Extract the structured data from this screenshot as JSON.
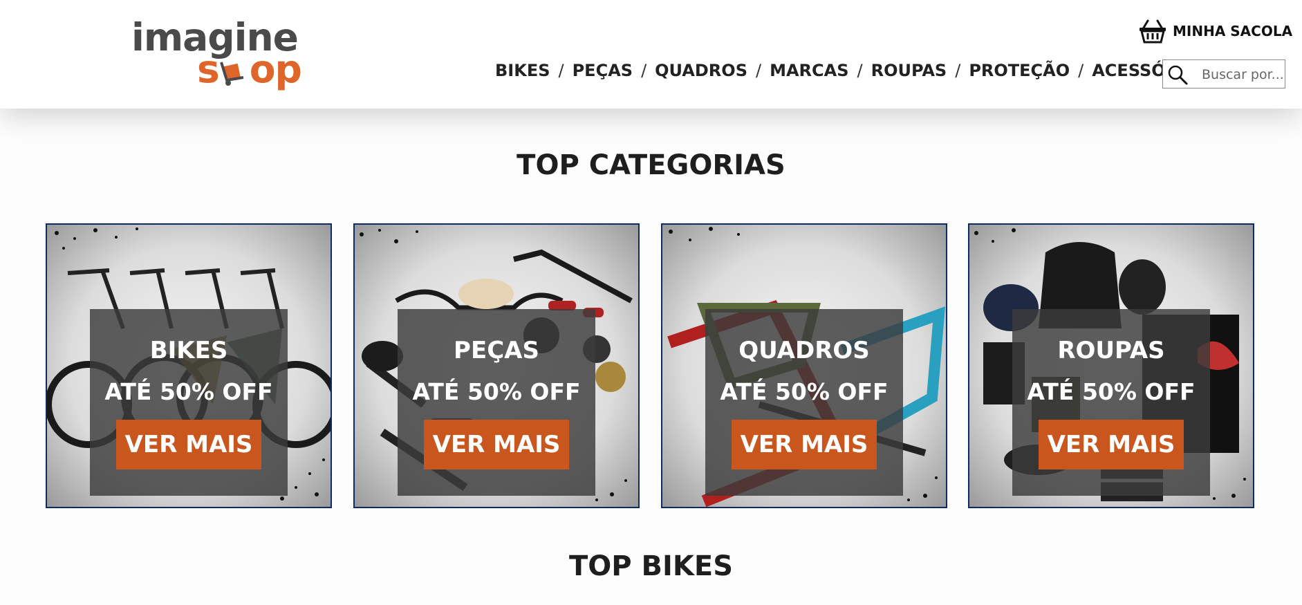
{
  "header": {
    "logo": {
      "line1": "imagine",
      "line2_part1": "s",
      "line2_part2": "op"
    },
    "bag_label": "MINHA SACOLA",
    "nav": [
      {
        "label": "BIKES"
      },
      {
        "label": "PEÇAS"
      },
      {
        "label": "QUADROS"
      },
      {
        "label": "MARCAS"
      },
      {
        "label": "ROUPAS"
      },
      {
        "label": "PROTEÇÃO"
      },
      {
        "label": "ACESSÓRIOS"
      }
    ],
    "nav_separator": "/",
    "search": {
      "placeholder": "Buscar por..."
    }
  },
  "sections": {
    "top_categories_title": "TOP CATEGORIAS",
    "top_bikes_title": "TOP BIKES"
  },
  "categories": [
    {
      "title": "BIKES",
      "promo": "ATÉ 50% OFF",
      "button": "VER MAIS",
      "art": "bikes"
    },
    {
      "title": "PEÇAS",
      "promo": "ATÉ 50% OFF",
      "button": "VER MAIS",
      "art": "parts"
    },
    {
      "title": "QUADROS",
      "promo": "ATÉ 50% OFF",
      "button": "VER MAIS",
      "art": "frames"
    },
    {
      "title": "ROUPAS",
      "promo": "ATÉ 50% OFF",
      "button": "VER MAIS",
      "art": "clothes"
    }
  ],
  "colors": {
    "accent": "#c8561d",
    "logo_orange": "#e0652a",
    "logo_gray": "#4a4a4a",
    "card_border": "#0c2a66",
    "overlay": "#3c3c3c"
  },
  "icons": {
    "bag": "shopping-basket-icon",
    "search": "magnifier-icon",
    "logo_cart": "hand-truck-icon"
  }
}
